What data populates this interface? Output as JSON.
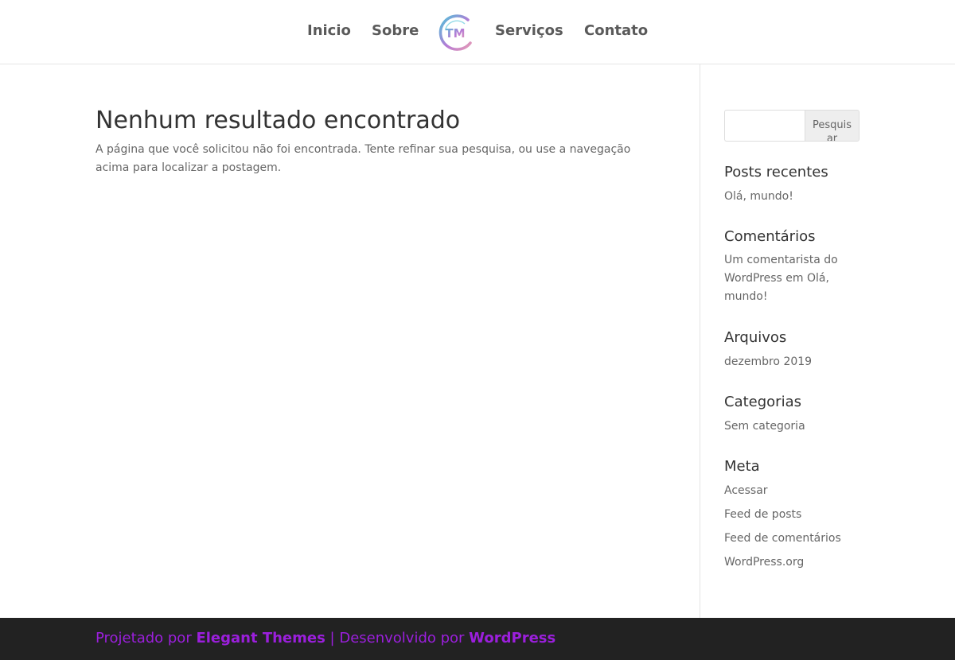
{
  "header": {
    "nav": {
      "inicio": "Inicio",
      "sobre": "Sobre",
      "servicos": "Serviços",
      "contato": "Contato"
    },
    "logo": {
      "text": "TM",
      "colors": [
        "#4fc3d9",
        "#b57ad6",
        "#e59bb5"
      ]
    }
  },
  "main": {
    "title": "Nenhum resultado encontrado",
    "message": "A página que você solicitou não foi encontrada. Tente refinar sua pesquisa, ou use a navegação acima para localizar a postagem."
  },
  "sidebar": {
    "search": {
      "value": "",
      "button_label": "Pesquisar"
    },
    "recent_posts": {
      "title": "Posts recentes",
      "items": [
        "Olá, mundo!"
      ]
    },
    "comments": {
      "title": "Comentários",
      "author": "Um comentarista do WordPress",
      "separator": " em ",
      "post": "Olá, mundo!"
    },
    "archives": {
      "title": "Arquivos",
      "items": [
        "dezembro 2019"
      ]
    },
    "categories": {
      "title": "Categorias",
      "items": [
        "Sem categoria"
      ]
    },
    "meta": {
      "title": "Meta",
      "items": [
        "Acessar",
        "Feed de posts",
        "Feed de comentários",
        "WordPress.org"
      ]
    }
  },
  "footer": {
    "prefix": "Projetado por ",
    "theme_link": "Elegant Themes",
    "middle": " | Desenvolvido por ",
    "wp_link": "WordPress",
    "text_color": "#9b1fdc",
    "background": "#222222"
  }
}
